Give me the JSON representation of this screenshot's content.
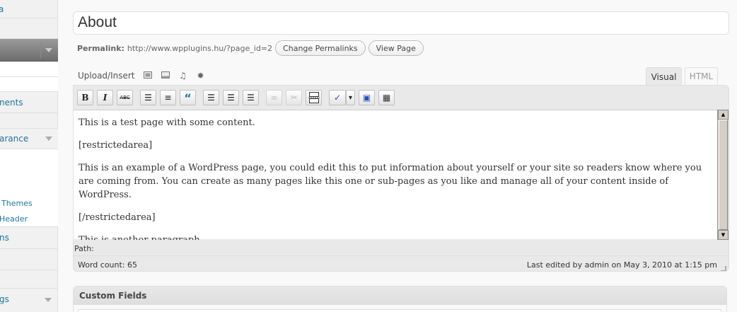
{
  "sidebar": {
    "items": [
      {
        "label": "a",
        "arrow": false
      },
      {
        "label": "nents",
        "arrow": false
      },
      {
        "label": "arance",
        "arrow": true
      },
      {
        "label": "ns",
        "arrow": false
      },
      {
        "label": "gs",
        "arrow": true
      }
    ],
    "subitems": [
      {
        "label": "Themes"
      },
      {
        "label": "Header"
      }
    ]
  },
  "title": {
    "value": "About"
  },
  "permalink": {
    "label": "Permalink:",
    "url": "http://www.wpplugins.hu/?page_id=2",
    "change_button": "Change Permalinks",
    "view_button": "View Page"
  },
  "media": {
    "label": "Upload/Insert",
    "icons": [
      "add-image-icon",
      "add-video-icon",
      "add-audio-icon",
      "add-media-icon"
    ]
  },
  "tabs": {
    "visual": "Visual",
    "html": "HTML"
  },
  "toolbar": {
    "buttons": [
      {
        "icon": "bold-icon",
        "glyph": "B"
      },
      {
        "icon": "italic-icon",
        "glyph": "I"
      },
      {
        "icon": "strikethrough-icon",
        "glyph": "ABC"
      },
      {
        "icon": "unordered-list-icon",
        "glyph": "☰"
      },
      {
        "icon": "ordered-list-icon",
        "glyph": "≡"
      },
      {
        "icon": "blockquote-icon",
        "glyph": "“"
      },
      {
        "icon": "align-left-icon",
        "glyph": "☰"
      },
      {
        "icon": "align-center-icon",
        "glyph": "☰"
      },
      {
        "icon": "align-right-icon",
        "glyph": "☰"
      },
      {
        "icon": "link-icon",
        "glyph": "∞"
      },
      {
        "icon": "unlink-icon",
        "glyph": "✂"
      },
      {
        "icon": "more-tag-icon",
        "glyph": "▭"
      },
      {
        "icon": "spellcheck-icon",
        "glyph": "✓"
      },
      {
        "icon": "spellcheck-dropdown-icon",
        "glyph": "▾"
      },
      {
        "icon": "fullscreen-icon",
        "glyph": "▣"
      },
      {
        "icon": "kitchen-sink-icon",
        "glyph": "▦"
      }
    ]
  },
  "content": {
    "paragraphs": [
      "This is a test page with some content.",
      "[restrictedarea]",
      "This is an example of a WordPress page, you could edit this to put information about yourself or your site so readers know where you are coming from. You can create as many pages like this one or sub-pages as you like and manage all of your content inside of WordPress.",
      "[/restrictedarea]",
      "This is another paragraph..."
    ]
  },
  "path": {
    "label": "Path:"
  },
  "status": {
    "word_count": "Word count: 65",
    "last_edited": "Last edited by admin on May 3, 2010 at 1:15 pm"
  },
  "custom_fields": {
    "title": "Custom Fields"
  }
}
